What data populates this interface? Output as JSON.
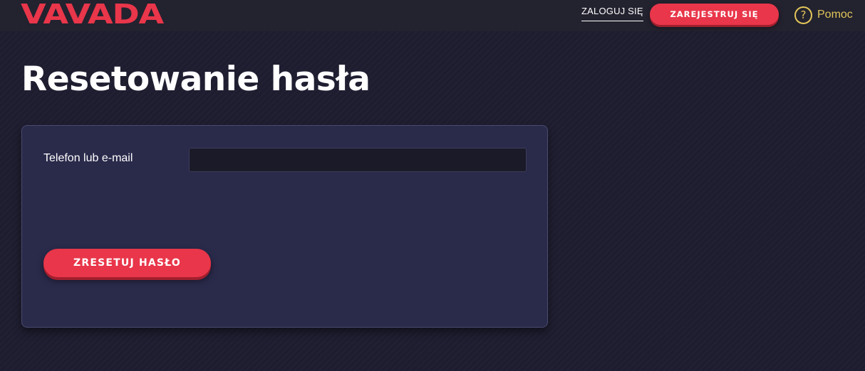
{
  "header": {
    "logo_text": "VAVADA",
    "login_label": "ZALOGUJ SIĘ",
    "register_label": "ZAREJESTRUJ SIĘ",
    "help_icon": "question-circle-icon",
    "help_label": "Pomoc"
  },
  "page": {
    "title": "Resetowanie hasła"
  },
  "form": {
    "field_label": "Telefon lub e-mail",
    "field_value": "",
    "submit_label": "ZRESETUJ HASŁO"
  },
  "colors": {
    "brand_red": "#e9364a",
    "help_yellow": "#e2c65a",
    "background": "#1e1d30",
    "card": "#2a2a4b"
  }
}
